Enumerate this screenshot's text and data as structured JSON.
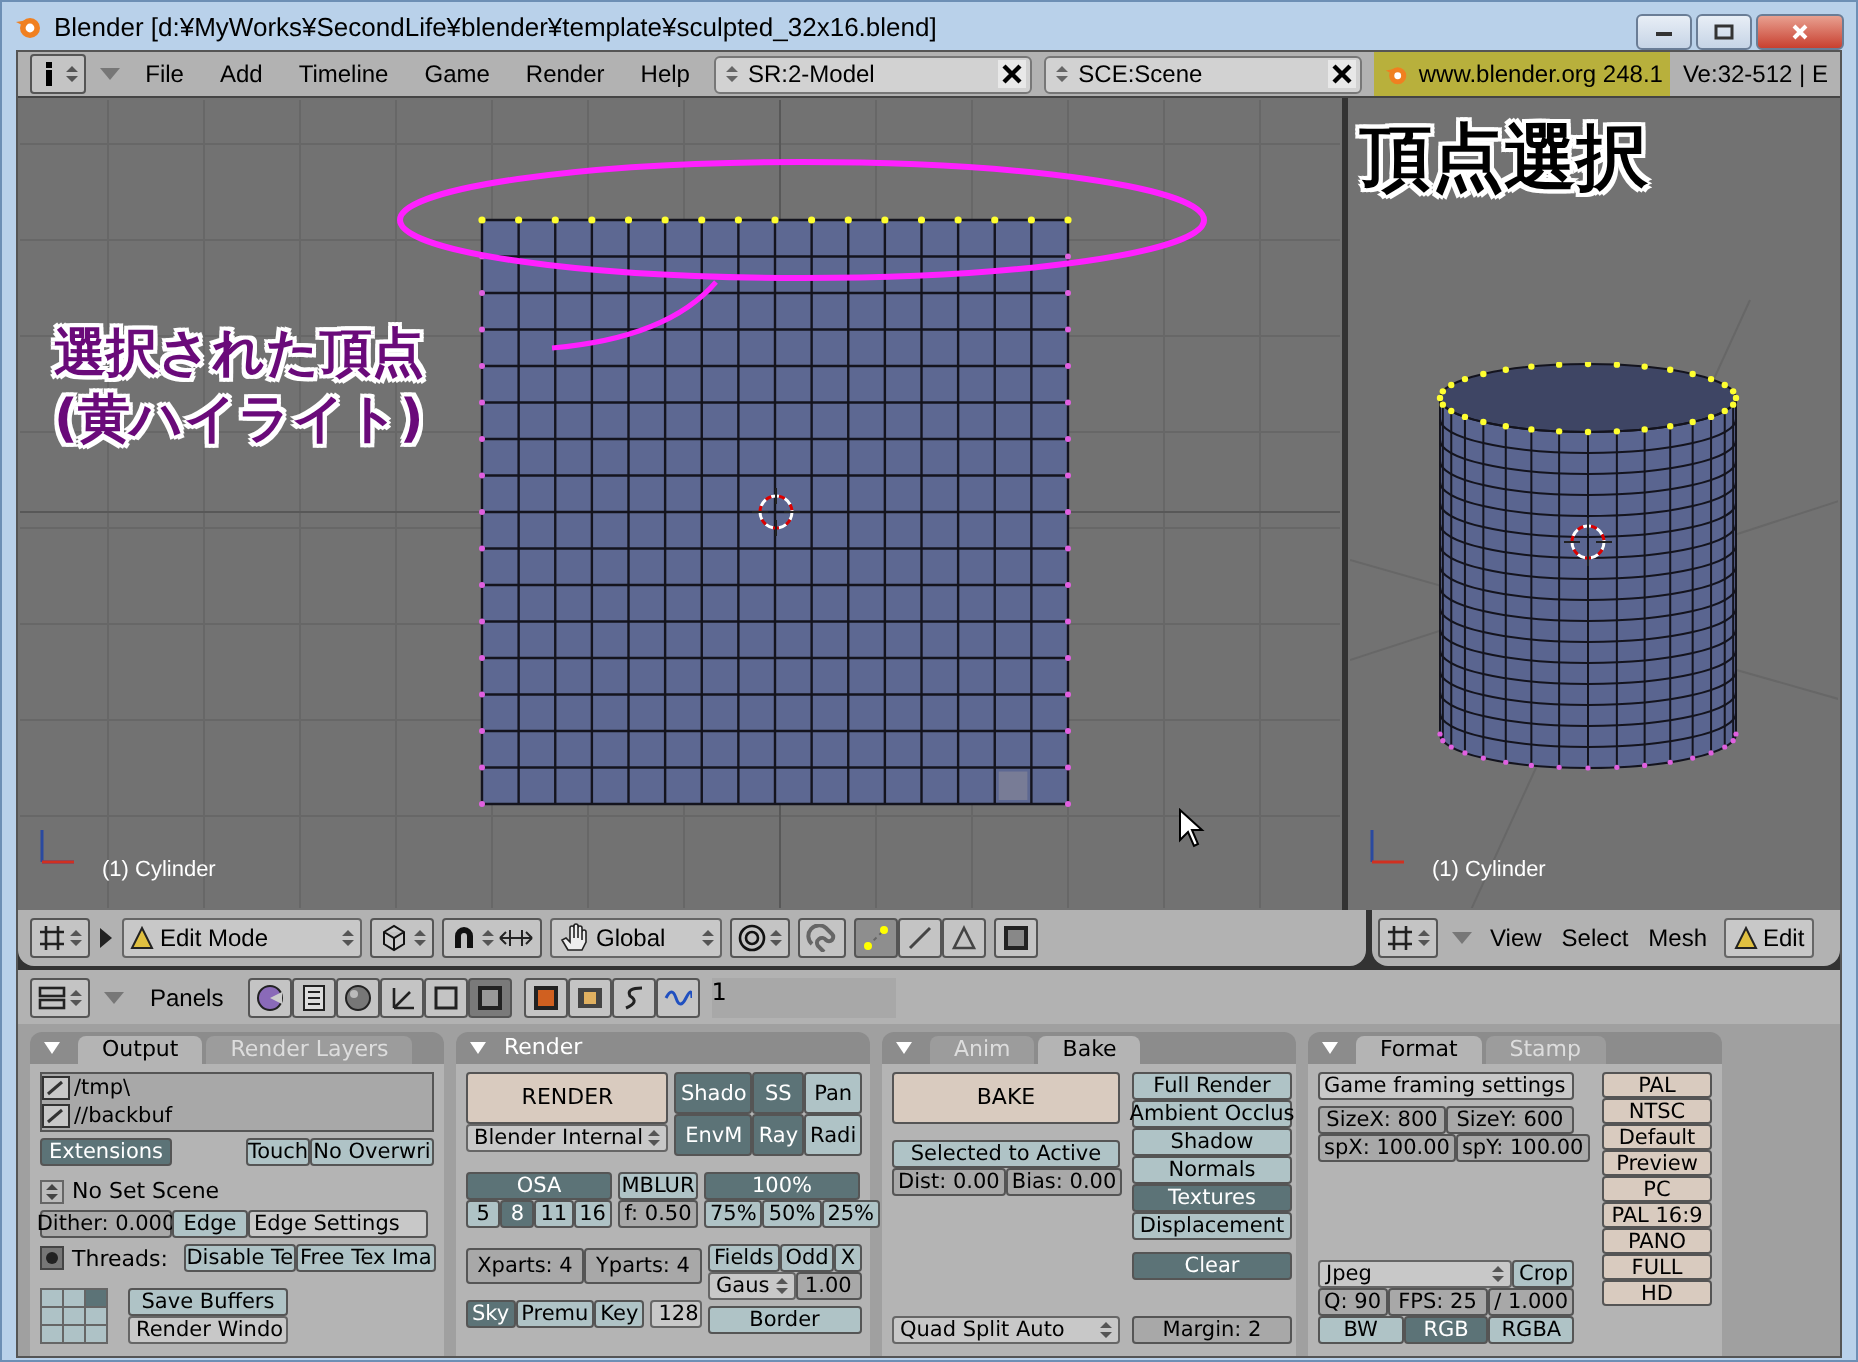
{
  "window": {
    "title": "Blender [d:¥MyWorks¥SecondLife¥blender¥template¥sculpted_32x16.blend]"
  },
  "top_header": {
    "menus": [
      "File",
      "Add",
      "Timeline",
      "Game",
      "Render",
      "Help"
    ],
    "screen": "SR:2-Model",
    "scene": "SCE:Scene",
    "site": "www.blender.org 248.1",
    "stats": "Ve:32-512 | E"
  },
  "viewport_left": {
    "annotation": [
      "選択された頂点",
      "(黄ハイライト)"
    ],
    "object": "(1) Cylinder"
  },
  "viewport_right": {
    "title": "頂点選択",
    "object": "(1) Cylinder"
  },
  "view3d_header": {
    "mode": "Edit Mode",
    "orientation": "Global",
    "select_modes": [
      {
        "kind": "vertex",
        "selected": true
      },
      {
        "kind": "edge",
        "selected": false
      },
      {
        "kind": "face",
        "selected": false
      }
    ]
  },
  "view3d_header_right": {
    "menus": [
      "View",
      "Select",
      "Mesh"
    ],
    "mode": "Edit"
  },
  "buttons_header": {
    "label": "Panels",
    "contexts": [
      {
        "kind": "logic",
        "selected": false
      },
      {
        "kind": "script",
        "selected": false
      },
      {
        "kind": "shading",
        "selected": false
      },
      {
        "kind": "object",
        "selected": false
      },
      {
        "kind": "editing",
        "selected": false
      },
      {
        "kind": "scene",
        "selected": true
      }
    ],
    "subcontexts": [
      {
        "kind": "render"
      },
      {
        "kind": "anim"
      },
      {
        "kind": "sound"
      },
      {
        "kind": "wave"
      }
    ],
    "frame": "1"
  },
  "output_panel": {
    "tabs": [
      {
        "label": "Output",
        "selected": true
      },
      {
        "label": "Render Layers",
        "selected": false
      }
    ],
    "paths": [
      "/tmp\\",
      "//backbuf"
    ],
    "extensions": {
      "label": "Extensions",
      "on": true
    },
    "touch": {
      "label": "Touch",
      "on": false
    },
    "no_overwrite": {
      "label": "No Overwri",
      "on": false
    },
    "set_scene": "No Set Scene",
    "dither": "Dither: 0.000",
    "edge": {
      "label": "Edge",
      "on": false
    },
    "edge_settings": "Edge Settings",
    "threads_label": "Threads:",
    "disable_tex": {
      "label": "Disable Te",
      "on": false
    },
    "free_tex": {
      "label": "Free Tex Ima",
      "on": false
    },
    "save_buffers": {
      "label": "Save Buffers",
      "on": false
    },
    "render_window": "Render Windo"
  },
  "render_panel": {
    "tab": "Render",
    "render_button": "RENDER",
    "engine": "Blender Internal",
    "toggles": [
      {
        "label": "Shado",
        "on": true
      },
      {
        "label": "SS",
        "on": true
      },
      {
        "label": "Pan",
        "on": false
      },
      {
        "label": "EnvM",
        "on": true
      },
      {
        "label": "Ray",
        "on": true
      },
      {
        "label": "Radi",
        "on": false
      }
    ],
    "osa": {
      "label": "OSA",
      "on": true
    },
    "osa_levels": [
      {
        "label": "5",
        "selected": false
      },
      {
        "label": "8",
        "selected": true
      },
      {
        "label": "11",
        "selected": false
      },
      {
        "label": "16",
        "selected": false
      }
    ],
    "mblur": {
      "label": "MBLUR",
      "on": false
    },
    "mblur_factor": "f: 0.50",
    "sizes": [
      {
        "label": "100%",
        "selected": true
      },
      {
        "label": "75%",
        "selected": false
      },
      {
        "label": "50%",
        "selected": false
      },
      {
        "label": "25%",
        "selected": false
      }
    ],
    "xparts": "Xparts: 4",
    "yparts": "Yparts: 4",
    "fields": {
      "label": "Fields",
      "on": false
    },
    "odd": {
      "label": "Odd",
      "on": false
    },
    "x": {
      "label": "X",
      "on": false
    },
    "filter": "Gaus",
    "filter_size": "1.00",
    "border": {
      "label": "Border",
      "on": false
    },
    "alpha": [
      {
        "label": "Sky",
        "selected": true
      },
      {
        "label": "Premu",
        "selected": false
      },
      {
        "label": "Key",
        "selected": false
      }
    ],
    "depth": "128"
  },
  "bake_panel": {
    "tabs": [
      {
        "label": "Anim",
        "selected": false
      },
      {
        "label": "Bake",
        "selected": true
      }
    ],
    "bake_button": "BAKE",
    "selected_to_active": {
      "label": "Selected to Active",
      "on": false
    },
    "dist": "Dist: 0.00",
    "bias": "Bias: 0.00",
    "modes": [
      {
        "label": "Full Render",
        "selected": false
      },
      {
        "label": "Ambient Occlus",
        "selected": false
      },
      {
        "label": "Shadow",
        "selected": false
      },
      {
        "label": "Normals",
        "selected": false
      },
      {
        "label": "Textures",
        "selected": true
      },
      {
        "label": "Displacement",
        "selected": false
      }
    ],
    "clear": "Clear",
    "split": "Quad Split Auto",
    "margin": "Margin: 2"
  },
  "format_panel": {
    "tabs": [
      {
        "label": "Format",
        "selected": true
      },
      {
        "label": "Stamp",
        "selected": false
      }
    ],
    "game_framing": "Game framing settings",
    "size_x": "SizeX: 800",
    "size_y": "SizeY: 600",
    "sp_x": "spX: 100.00",
    "sp_y": "spY: 100.00",
    "file_type": "Jpeg",
    "crop": {
      "label": "Crop",
      "on": false
    },
    "quality": "Q: 90",
    "fps": "FPS: 25",
    "fps_base": "/ 1.000",
    "color_modes": [
      {
        "label": "BW",
        "selected": false
      },
      {
        "label": "RGB",
        "selected": true
      },
      {
        "label": "RGBA",
        "selected": false
      }
    ],
    "presets": [
      "PAL",
      "NTSC",
      "Default",
      "Preview",
      "PC",
      "PAL 16:9",
      "PANO",
      "FULL",
      "HD"
    ]
  }
}
